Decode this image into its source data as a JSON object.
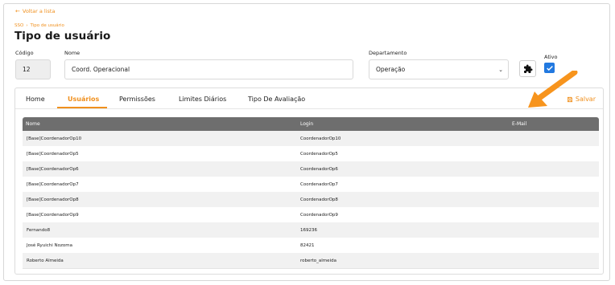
{
  "back_link": "Voltar a lista",
  "breadcrumb": [
    "SSO",
    "Tipo de usuário"
  ],
  "page_title": "Tipo de usuário",
  "form": {
    "codigo_label": "Código",
    "codigo_value": "12",
    "nome_label": "Nome",
    "nome_value": "Coord. Operacional",
    "departamento_label": "Departamento",
    "departamento_value": "Operação",
    "ativo_label": "Ativo",
    "ativo_checked": true
  },
  "tabs": [
    {
      "label": "Home",
      "active": false
    },
    {
      "label": "Usuários",
      "active": true
    },
    {
      "label": "Permissões",
      "active": false
    },
    {
      "label": "Limites Diários",
      "active": false
    },
    {
      "label": "Tipo De Avaliação",
      "active": false
    }
  ],
  "save_label": "Salvar",
  "table": {
    "headers": [
      "Nome",
      "Login",
      "E-Mail"
    ],
    "rows": [
      [
        "[Base]CoordenadorOp10",
        "CoordenadorOp10",
        ""
      ],
      [
        "[Base]CoordenadorOp5",
        "CoordenadorOp5",
        ""
      ],
      [
        "[Base]CoordenadorOp6",
        "CoordenadorOp6",
        ""
      ],
      [
        "[Base]CoordenadorOp7",
        "CoordenadorOp7",
        ""
      ],
      [
        "[Base]CoordenadorOp8",
        "CoordenadorOp8",
        ""
      ],
      [
        "[Base]CoordenadorOp9",
        "CoordenadorOp9",
        ""
      ],
      [
        "Fernando8",
        "169236",
        ""
      ],
      [
        "José Ryuichi Nozoma",
        "82421",
        ""
      ],
      [
        "Roberto Almeida",
        "roberto_almeida",
        ""
      ]
    ]
  },
  "colors": {
    "accent": "#f0901e",
    "header_bg": "#6e6e6e",
    "checkbox": "#2279e0"
  },
  "icons": {
    "back": "arrow-left-icon",
    "puzzle": "puzzle-icon",
    "save": "save-icon",
    "chevron": "chevron-down-icon",
    "check": "check-icon"
  }
}
